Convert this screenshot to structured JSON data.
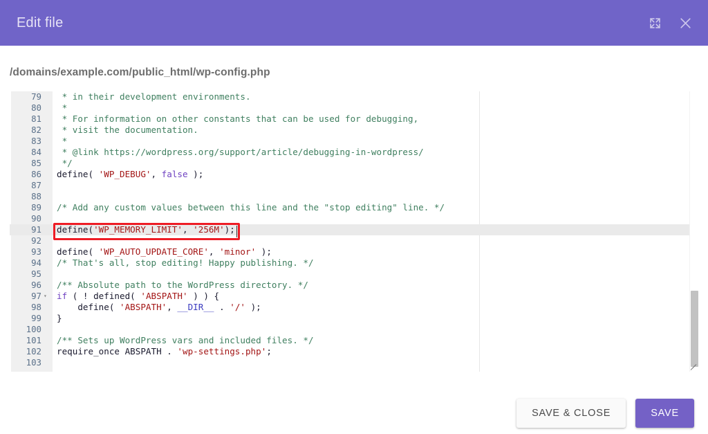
{
  "header": {
    "title": "Edit file",
    "expand_icon": "expand-icon",
    "close_icon": "close-icon"
  },
  "file": {
    "path": "/domains/example.com/public_html/wp-config.php"
  },
  "editor": {
    "active_line": 91,
    "fold_line": 97,
    "ruler_column": 80,
    "lines": [
      {
        "n": "79",
        "fold": "",
        "tokens": [
          {
            "t": " * in their development environments.",
            "c": "c"
          }
        ]
      },
      {
        "n": "80",
        "fold": "",
        "tokens": [
          {
            "t": " *",
            "c": "c"
          }
        ]
      },
      {
        "n": "81",
        "fold": "",
        "tokens": [
          {
            "t": " * For information on other constants that can be used for debugging,",
            "c": "c"
          }
        ]
      },
      {
        "n": "82",
        "fold": "",
        "tokens": [
          {
            "t": " * visit the documentation.",
            "c": "c"
          }
        ]
      },
      {
        "n": "83",
        "fold": "",
        "tokens": [
          {
            "t": " *",
            "c": "c"
          }
        ]
      },
      {
        "n": "84",
        "fold": "",
        "tokens": [
          {
            "t": " * @link https://wordpress.org/support/article/debugging-in-wordpress/",
            "c": "c"
          }
        ]
      },
      {
        "n": "85",
        "fold": "",
        "tokens": [
          {
            "t": " */",
            "c": "c"
          }
        ]
      },
      {
        "n": "86",
        "fold": "",
        "tokens": [
          {
            "t": "define(",
            "c": "f"
          },
          {
            "t": " ",
            "c": "p"
          },
          {
            "t": "'WP_DEBUG'",
            "c": "s"
          },
          {
            "t": ", ",
            "c": "p"
          },
          {
            "t": "false",
            "c": "k"
          },
          {
            "t": " );",
            "c": "p"
          }
        ]
      },
      {
        "n": "87",
        "fold": "",
        "tokens": [
          {
            "t": "",
            "c": "p"
          }
        ]
      },
      {
        "n": "88",
        "fold": "",
        "tokens": [
          {
            "t": "",
            "c": "p"
          }
        ]
      },
      {
        "n": "89",
        "fold": "",
        "tokens": [
          {
            "t": "/* Add any custom values between this line and the \"stop editing\" line. */",
            "c": "c"
          }
        ]
      },
      {
        "n": "90",
        "fold": "",
        "tokens": [
          {
            "t": "",
            "c": "p"
          }
        ]
      },
      {
        "n": "91",
        "fold": "",
        "tokens": [
          {
            "t": "define(",
            "c": "f"
          },
          {
            "t": "'WP_MEMORY_LIMIT'",
            "c": "s"
          },
          {
            "t": ", ",
            "c": "p"
          },
          {
            "t": "'256M'",
            "c": "s"
          },
          {
            "t": ");",
            "c": "p"
          }
        ]
      },
      {
        "n": "92",
        "fold": "",
        "tokens": [
          {
            "t": "",
            "c": "p"
          }
        ]
      },
      {
        "n": "93",
        "fold": "",
        "tokens": [
          {
            "t": "define(",
            "c": "f"
          },
          {
            "t": " ",
            "c": "p"
          },
          {
            "t": "'WP_AUTO_UPDATE_CORE'",
            "c": "s"
          },
          {
            "t": ", ",
            "c": "p"
          },
          {
            "t": "'minor'",
            "c": "s"
          },
          {
            "t": " );",
            "c": "p"
          }
        ]
      },
      {
        "n": "94",
        "fold": "",
        "tokens": [
          {
            "t": "/* That's all, stop editing! Happy publishing. */",
            "c": "c"
          }
        ]
      },
      {
        "n": "95",
        "fold": "",
        "tokens": [
          {
            "t": "",
            "c": "p"
          }
        ]
      },
      {
        "n": "96",
        "fold": "",
        "tokens": [
          {
            "t": "/** Absolute path to the WordPress directory. */",
            "c": "c"
          }
        ]
      },
      {
        "n": "97",
        "fold": "▾",
        "tokens": [
          {
            "t": "if",
            "c": "k"
          },
          {
            "t": " ( ! ",
            "c": "p"
          },
          {
            "t": "defined(",
            "c": "f"
          },
          {
            "t": " ",
            "c": "p"
          },
          {
            "t": "'ABSPATH'",
            "c": "s"
          },
          {
            "t": " ) ) {",
            "c": "p"
          }
        ]
      },
      {
        "n": "98",
        "fold": "",
        "tokens": [
          {
            "t": "    define(",
            "c": "f"
          },
          {
            "t": " ",
            "c": "p"
          },
          {
            "t": "'ABSPATH'",
            "c": "s"
          },
          {
            "t": ", ",
            "c": "p"
          },
          {
            "t": "__DIR__",
            "c": "m"
          },
          {
            "t": " . ",
            "c": "p"
          },
          {
            "t": "'/'",
            "c": "s"
          },
          {
            "t": " );",
            "c": "p"
          }
        ]
      },
      {
        "n": "99",
        "fold": "",
        "tokens": [
          {
            "t": "}",
            "c": "p"
          }
        ]
      },
      {
        "n": "100",
        "fold": "",
        "tokens": [
          {
            "t": "",
            "c": "p"
          }
        ]
      },
      {
        "n": "101",
        "fold": "",
        "tokens": [
          {
            "t": "/** Sets up WordPress vars and included files. */",
            "c": "c"
          }
        ]
      },
      {
        "n": "102",
        "fold": "",
        "tokens": [
          {
            "t": "require_once",
            "c": "f"
          },
          {
            "t": " ABSPATH . ",
            "c": "p"
          },
          {
            "t": "'wp-settings.php'",
            "c": "s"
          },
          {
            "t": ";",
            "c": "p"
          }
        ]
      },
      {
        "n": "103",
        "fold": "",
        "tokens": [
          {
            "t": "",
            "c": "p"
          }
        ]
      }
    ]
  },
  "footer": {
    "save_close_label": "SAVE & CLOSE",
    "save_label": "SAVE"
  },
  "colors": {
    "header_purple": "#7064c8",
    "primary_button": "#7461c6",
    "annotation_red": "#ee1c25",
    "comment": "#3f7f5f",
    "string": "#a31515",
    "keyword": "#6f42c1"
  }
}
